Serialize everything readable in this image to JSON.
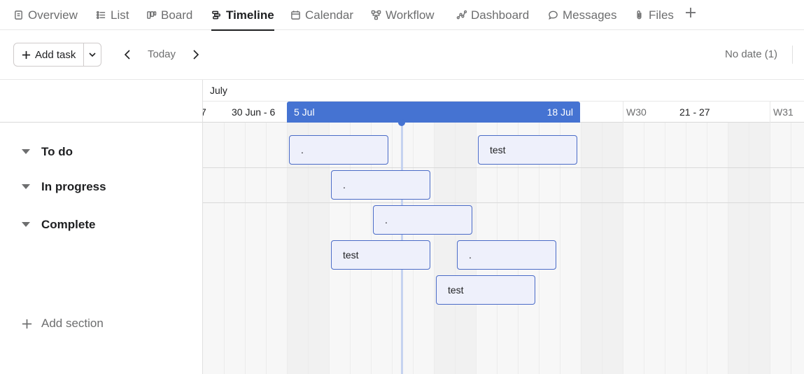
{
  "tabs": [
    {
      "label": "Overview",
      "icon": "overview-icon",
      "active": false
    },
    {
      "label": "List",
      "icon": "list-icon",
      "active": false
    },
    {
      "label": "Board",
      "icon": "board-icon",
      "active": false
    },
    {
      "label": "Timeline",
      "icon": "timeline-icon",
      "active": true
    },
    {
      "label": "Calendar",
      "icon": "calendar-icon",
      "active": false
    },
    {
      "label": "Workflow",
      "icon": "workflow-icon",
      "active": false
    },
    {
      "label": "Dashboard",
      "icon": "dashboard-icon",
      "active": false
    },
    {
      "label": "Messages",
      "icon": "messages-icon",
      "active": false
    },
    {
      "label": "Files",
      "icon": "files-icon",
      "active": false
    }
  ],
  "toolbar": {
    "add_task_label": "Add task",
    "today_label": "Today",
    "no_date_label": "No date (1)"
  },
  "timeline": {
    "month": "July",
    "weeks": [
      "7",
      "30 Jun - 6",
      "W30",
      "21 - 27",
      "W31"
    ],
    "selected_range": {
      "start": "5 Jul",
      "end": "18 Jul"
    }
  },
  "sections": [
    {
      "name": "To do"
    },
    {
      "name": "In progress"
    },
    {
      "name": "Complete"
    }
  ],
  "add_section_label": "Add section",
  "tasks": [
    {
      "title": ".",
      "section": "To do"
    },
    {
      "title": "test",
      "section": "To do"
    },
    {
      "title": ".",
      "section": "In progress"
    },
    {
      "title": ".",
      "section": "Complete"
    },
    {
      "title": "test",
      "section": "Complete"
    },
    {
      "title": ".",
      "section": "Complete"
    },
    {
      "title": "test",
      "section": "Complete"
    }
  ],
  "colors": {
    "accent": "#4573d2",
    "task_border": "#4a6bc7",
    "task_fill": "#eef0fb",
    "text_primary": "#1e1f21",
    "text_secondary": "#6d6e6f"
  }
}
